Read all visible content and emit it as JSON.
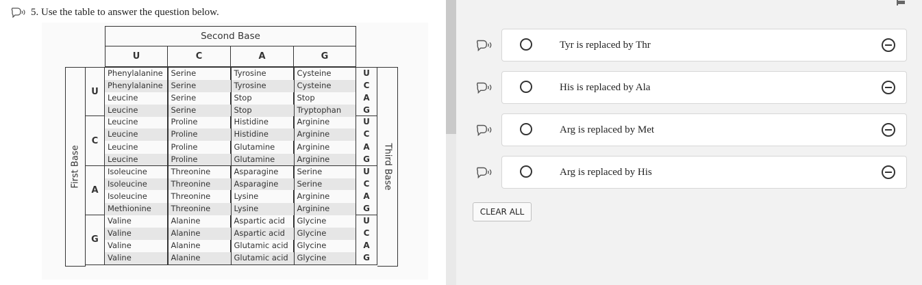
{
  "question": {
    "number": "5.",
    "text": "Use the table to answer the question below."
  },
  "table": {
    "header_second_base": "Second Base",
    "first_base_label": "First Base",
    "third_base_label": "Third Base",
    "columns": [
      "U",
      "C",
      "A",
      "G"
    ],
    "blocks": [
      {
        "first": "U",
        "rows": [
          [
            "Phenylalanine",
            "Serine",
            "Tyrosine",
            "Cysteine",
            "U"
          ],
          [
            "Phenylalanine",
            "Serine",
            "Tyrosine",
            "Cysteine",
            "C"
          ],
          [
            "Leucine",
            "Serine",
            "Stop",
            "Stop",
            "A"
          ],
          [
            "Leucine",
            "Serine",
            "Stop",
            "Tryptophan",
            "G"
          ]
        ]
      },
      {
        "first": "C",
        "rows": [
          [
            "Leucine",
            "Proline",
            "Histidine",
            "Arginine",
            "U"
          ],
          [
            "Leucine",
            "Proline",
            "Histidine",
            "Arginine",
            "C"
          ],
          [
            "Leucine",
            "Proline",
            "Glutamine",
            "Arginine",
            "A"
          ],
          [
            "Leucine",
            "Proline",
            "Glutamine",
            "Arginine",
            "G"
          ]
        ]
      },
      {
        "first": "A",
        "rows": [
          [
            "Isoleucine",
            "Threonine",
            "Asparagine",
            "Serine",
            "U"
          ],
          [
            "Isoleucine",
            "Threonine",
            "Asparagine",
            "Serine",
            "C"
          ],
          [
            "Isoleucine",
            "Threonine",
            "Lysine",
            "Arginine",
            "A"
          ],
          [
            "Methionine",
            "Threonine",
            "Lysine",
            "Arginine",
            "G"
          ]
        ]
      },
      {
        "first": "G",
        "rows": [
          [
            "Valine",
            "Alanine",
            "Aspartic acid",
            "Glycine",
            "U"
          ],
          [
            "Valine",
            "Alanine",
            "Aspartic acid",
            "Glycine",
            "C"
          ],
          [
            "Valine",
            "Alanine",
            "Glutamic acid",
            "Glycine",
            "A"
          ],
          [
            "Valine",
            "Alanine",
            "Glutamic acid",
            "Glycine",
            "G"
          ]
        ]
      }
    ]
  },
  "options": [
    {
      "label": "Tyr is replaced by Thr"
    },
    {
      "label": "His is replaced by Ala"
    },
    {
      "label": "Arg is replaced by Met"
    },
    {
      "label": "Arg is replaced by His"
    }
  ],
  "clear_all": "CLEAR ALL",
  "icons": {
    "speaker": "speaker-icon",
    "strike": "eliminate-icon",
    "flag": "flag-icon"
  }
}
